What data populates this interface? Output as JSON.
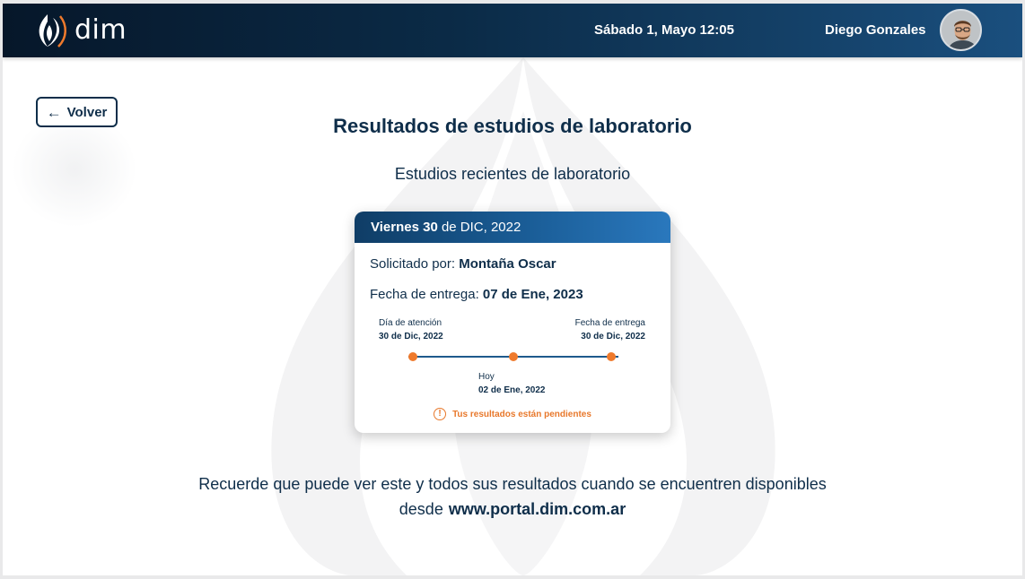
{
  "header": {
    "logo_text": "dim",
    "date_prefix": "Sábado 1, Mayo ",
    "time": "12:05",
    "user_name": "Diego Gonzales"
  },
  "back_button": {
    "label": "Volver"
  },
  "page": {
    "title": "Resultados de estudios de laboratorio",
    "subtitle": "Estudios recientes de laboratorio"
  },
  "study_card": {
    "day_bold": "Viernes 30",
    "date_rest": " de DIC, 2022",
    "requested_label": "Solicitado por: ",
    "requested_by": "Montaña Oscar",
    "delivery_label": "Fecha de entrega: ",
    "delivery_date": "07 de Ene, 2023",
    "timeline": {
      "start_label": "Día de atención",
      "start_date": "30 de Dic, 2022",
      "end_label": "Fecha de entrega",
      "end_date": "30 de Dic, 2022",
      "today_label": "Hoy",
      "today_date": "02 de Ene, 2022"
    },
    "status_text": "Tus resultados están pendientes"
  },
  "footer": {
    "line1": "Recuerde que puede ver este y todos sus resultados cuando se encuentren disponibles",
    "line2_prefix": "desde",
    "url": "www.portal.dim.com.ar"
  },
  "colors": {
    "navy": "#0f2e4a",
    "accent_orange": "#ef7a2c",
    "header_blue": "#1a4f7e"
  }
}
